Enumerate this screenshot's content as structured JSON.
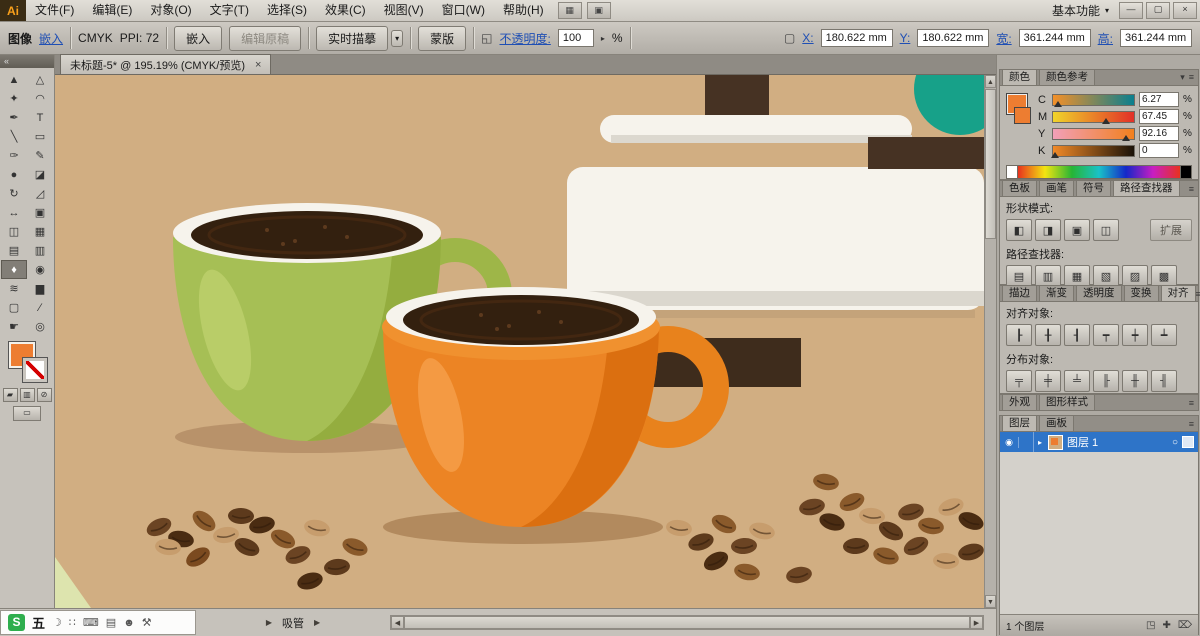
{
  "glyphs": {
    "chevron_down": "▾",
    "small_right": "▸",
    "collapse": "«",
    "close": "×",
    "minimize": "—",
    "restore": "▢",
    "scroll_up": "▲",
    "scroll_down": "▼",
    "scroll_left": "◀",
    "scroll_right": "▶",
    "status_arrow": "▶",
    "panel_menu": "≡",
    "eye": "◉",
    "target": "○",
    "expand_row": "▸",
    "style_icon": "◱",
    "swatch_none": "⊘",
    "swatch_color": "▰",
    "swatch_gradient": "▥",
    "screen_mode": "▭"
  },
  "menu_bar": {
    "logo_text": "Ai",
    "items": [
      "文件(F)",
      "编辑(E)",
      "对象(O)",
      "文字(T)",
      "选择(S)",
      "效果(C)",
      "视图(V)",
      "窗口(W)",
      "帮助(H)"
    ],
    "app_icons": [
      {
        "name": "bridge-icon",
        "glyph": "▦"
      },
      {
        "name": "arrange-documents-icon",
        "glyph": "▣"
      }
    ],
    "workspace_label": "基本功能"
  },
  "control_bar": {
    "context_label": "图像",
    "embed_link": "嵌入",
    "color_mode": "CMYK",
    "ppi_label": "PPI: 72",
    "embed_button": "嵌入",
    "edit_original_button": "编辑原稿",
    "live_trace_button": "实时描摹",
    "mask_button": "蒙版",
    "opacity_label": "不透明度:",
    "opacity_value": "100",
    "opacity_unit": "%",
    "fields": [
      {
        "label": "X:",
        "value": "180.622 mm"
      },
      {
        "label": "Y:",
        "value": "180.622 mm"
      },
      {
        "label": "宽:",
        "value": "361.244 mm"
      },
      {
        "label": "高:",
        "value": "361.244 mm"
      }
    ]
  },
  "document_tab": {
    "title": "未标题-5* @ 195.19% (CMYK/预览)"
  },
  "toolbar": {
    "tools": [
      {
        "name": "selection-tool",
        "glyph": "▲"
      },
      {
        "name": "direct-selection-tool",
        "glyph": "△"
      },
      {
        "name": "magic-wand-tool",
        "glyph": "✦"
      },
      {
        "name": "lasso-tool",
        "glyph": "◠"
      },
      {
        "name": "pen-tool",
        "glyph": "✒"
      },
      {
        "name": "type-tool",
        "glyph": "T"
      },
      {
        "name": "line-segment-tool",
        "glyph": "╲"
      },
      {
        "name": "rectangle-tool",
        "glyph": "▭"
      },
      {
        "name": "paintbrush-tool",
        "glyph": "✑"
      },
      {
        "name": "pencil-tool",
        "glyph": "✎"
      },
      {
        "name": "blob-brush-tool",
        "glyph": "●"
      },
      {
        "name": "eraser-tool",
        "glyph": "◪"
      },
      {
        "name": "rotate-tool",
        "glyph": "↻"
      },
      {
        "name": "scale-tool",
        "glyph": "◿"
      },
      {
        "name": "width-tool",
        "glyph": "↔"
      },
      {
        "name": "free-transform-tool",
        "glyph": "▣"
      },
      {
        "name": "shape-builder-tool",
        "glyph": "◫"
      },
      {
        "name": "perspective-grid-tool",
        "glyph": "▦"
      },
      {
        "name": "mesh-tool",
        "glyph": "▤"
      },
      {
        "name": "gradient-tool",
        "glyph": "▥"
      },
      {
        "name": "eyedropper-tool",
        "glyph": "♦",
        "active": true
      },
      {
        "name": "blend-tool",
        "glyph": "◉"
      },
      {
        "name": "symbol-sprayer-tool",
        "glyph": "≋"
      },
      {
        "name": "column-graph-tool",
        "glyph": "▆"
      },
      {
        "name": "artboard-tool",
        "glyph": "▢"
      },
      {
        "name": "slice-tool",
        "glyph": "∕"
      },
      {
        "name": "hand-tool",
        "glyph": "☛"
      },
      {
        "name": "zoom-tool",
        "glyph": "◎"
      }
    ],
    "fill_color": "#ed7d31"
  },
  "canvas_palette": {
    "artboard_bg": "#d1ae82",
    "cup_green": "#a6bf55",
    "cup_green_shade": "#94ad3f",
    "cup_orange": "#ec8424",
    "cup_orange_shade": "#db6f10",
    "coffee": "#33200f",
    "rim_white": "#f6f3ec",
    "machine_white": "#f6f3ec",
    "machine_brown": "#463223",
    "teal_ball": "#17a189",
    "bean_dark": "#4a2c12",
    "bean_mid": "#8a5a2b",
    "bean_light": "#c79d6d",
    "shadow_tan": "#b8926a"
  },
  "right_panels": {
    "color_panel": {
      "tabs": [
        "颜色",
        "颜色参考"
      ],
      "sliders": [
        {
          "channel": "C",
          "value": "6.27",
          "marker_style": "left:6%"
        },
        {
          "channel": "M",
          "value": "67.45",
          "marker_style": "left:66%"
        },
        {
          "channel": "Y",
          "value": "92.16",
          "marker_style": "left:90%"
        },
        {
          "channel": "K",
          "value": "0",
          "marker_style": "left:2%"
        }
      ],
      "unit": "%"
    },
    "swatches_strip_tabs": [
      "色板",
      "画笔",
      "符号",
      "路径查找器"
    ],
    "pathfinder_panel": {
      "shape_modes_label": "形状模式:",
      "expand_button": "扩展",
      "pathfinders_label": "路径查找器:",
      "shape_mode_icons": [
        {
          "name": "unite",
          "glyph": "◧"
        },
        {
          "name": "minus-front",
          "glyph": "◨"
        },
        {
          "name": "intersect",
          "glyph": "▣"
        },
        {
          "name": "exclude",
          "glyph": "◫"
        }
      ],
      "pathfinder_icons": [
        {
          "name": "divide",
          "glyph": "▤"
        },
        {
          "name": "trim",
          "glyph": "▥"
        },
        {
          "name": "merge",
          "glyph": "▦"
        },
        {
          "name": "crop",
          "glyph": "▧"
        },
        {
          "name": "outline",
          "glyph": "▨"
        },
        {
          "name": "minus-back",
          "glyph": "▩"
        }
      ]
    },
    "stroke_strip_tabs": [
      "描边",
      "渐变",
      "透明度",
      "变换",
      "对齐"
    ],
    "align_panel": {
      "align_objects_label": "对齐对象:",
      "distribute_objects_label": "分布对象:",
      "align_icons": [
        {
          "name": "align-left",
          "glyph": "┠"
        },
        {
          "name": "align-h-center",
          "glyph": "╂"
        },
        {
          "name": "align-right",
          "glyph": "┨"
        },
        {
          "name": "align-top",
          "glyph": "┯"
        },
        {
          "name": "align-v-center",
          "glyph": "┿"
        },
        {
          "name": "align-bottom",
          "glyph": "┷"
        }
      ],
      "distribute_icons": [
        {
          "name": "distribute-top",
          "glyph": "╤"
        },
        {
          "name": "distribute-v-center",
          "glyph": "╪"
        },
        {
          "name": "distribute-bottom",
          "glyph": "╧"
        },
        {
          "name": "distribute-left",
          "glyph": "╟"
        },
        {
          "name": "distribute-h-center",
          "glyph": "╫"
        },
        {
          "name": "distribute-right",
          "glyph": "╢"
        }
      ]
    },
    "appearance_strip_tabs": [
      "外观",
      "图形样式"
    ],
    "layers_panel": {
      "tabs": [
        "图层",
        "画板"
      ],
      "rows": [
        {
          "name": "图层 1"
        }
      ],
      "footer_label": "1 个图层",
      "footer_icons": [
        {
          "name": "make-mask-icon",
          "glyph": "◳"
        },
        {
          "name": "new-layer-icon",
          "glyph": "✚"
        },
        {
          "name": "delete-layer-icon",
          "glyph": "⌦"
        }
      ]
    }
  },
  "status_bar": {
    "tool_name": "吸管"
  },
  "ime_bar": {
    "brand_glyph": "S",
    "mode_label": "五",
    "icons": [
      {
        "name": "moon-icon",
        "glyph": "☽"
      },
      {
        "name": "punctuation-icon",
        "glyph": "∷"
      },
      {
        "name": "keyboard-icon",
        "glyph": "⌨"
      },
      {
        "name": "clipboard-icon",
        "glyph": "▤"
      },
      {
        "name": "avatar-icon",
        "glyph": "☻"
      },
      {
        "name": "wrench-icon",
        "glyph": "⚒"
      }
    ]
  }
}
